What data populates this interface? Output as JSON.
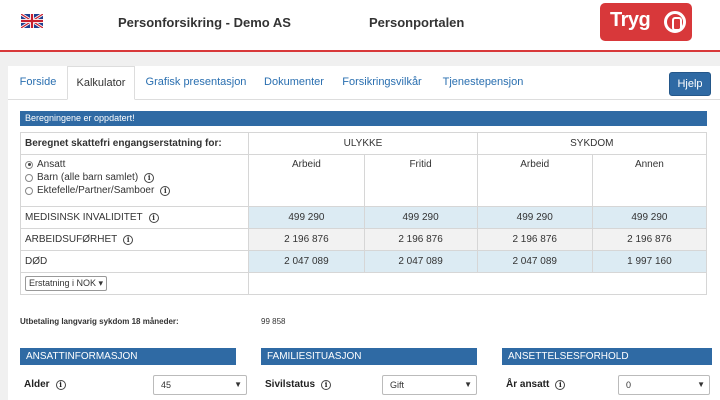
{
  "header": {
    "flag_icon": "uk-flag-icon",
    "company": "Personforsikring - Demo AS",
    "portal": "Personportalen",
    "logo_text": "Tryg",
    "brand_color": "#d8383a"
  },
  "tabs": [
    "Forside",
    "Kalkulator",
    "Grafisk presentasjon",
    "Dokumenter",
    "Forsikringsvilkår",
    "Tjenestepensjon"
  ],
  "active_tab": "Kalkulator",
  "help_label": "Hjelp",
  "banner": "Beregningene er oppdatert!",
  "calc": {
    "title": "Beregnet skattefri engangserstatning for:",
    "groups": [
      "ULYKKE",
      "SYKDOM"
    ],
    "subheads": [
      "Arbeid",
      "Fritid",
      "Arbeid",
      "Annen"
    ],
    "radios": [
      {
        "label": "Ansatt",
        "checked": true,
        "info": false
      },
      {
        "label": "Barn (alle barn samlet)",
        "checked": false,
        "info": true
      },
      {
        "label": "Ektefelle/Partner/Samboer",
        "checked": false,
        "info": true
      }
    ],
    "rows": [
      {
        "label": "MEDISINSK INVALIDITET",
        "info": true,
        "values": [
          "499 290",
          "499 290",
          "499 290",
          "499 290"
        ]
      },
      {
        "label": "ARBEIDSUFØRHET",
        "info": true,
        "values": [
          "2 196 876",
          "2 196 876",
          "2 196 876",
          "2 196 876"
        ]
      },
      {
        "label": "DØD",
        "info": false,
        "values": [
          "2 047 089",
          "2 047 089",
          "2 047 089",
          "1 997 160"
        ]
      }
    ],
    "currency_select": "Erstatning i NOK"
  },
  "payout": {
    "label": "Utbetaling langvarig sykdom 18 måneder:",
    "value": "99 858"
  },
  "sections": [
    {
      "title": "ANSATTINFORMASJON",
      "field_label": "Alder",
      "field_value": "45"
    },
    {
      "title": "FAMILIESITUASJON",
      "field_label": "Sivilstatus",
      "field_value": "Gift"
    },
    {
      "title": "ANSETTELSESFORHOLD",
      "field_label": "År ansatt",
      "field_value": "0"
    }
  ]
}
